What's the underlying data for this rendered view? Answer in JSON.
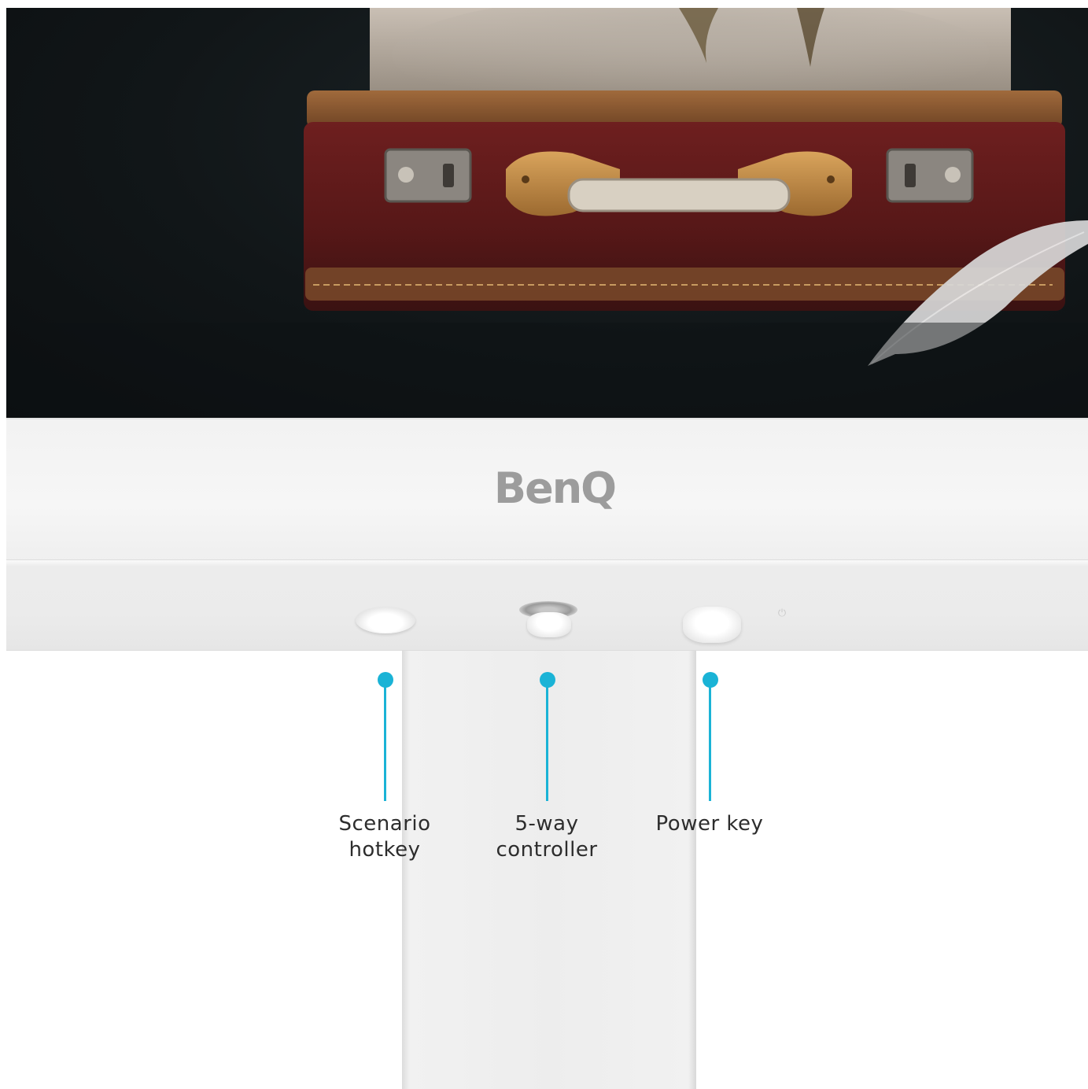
{
  "brand": {
    "logo_text": "BenQ"
  },
  "callouts": [
    {
      "line1": "Scenario",
      "line2": "hotkey"
    },
    {
      "line1": "5-way",
      "line2": "controller"
    },
    {
      "line1": "Power key",
      "line2": ""
    }
  ],
  "colors": {
    "accent": "#1ab3d6",
    "logo": "#9c9c9c",
    "label": "#2d2d2d",
    "bezel": "#f4f4f4"
  },
  "icons": {
    "power_indicator": "power-icon"
  }
}
